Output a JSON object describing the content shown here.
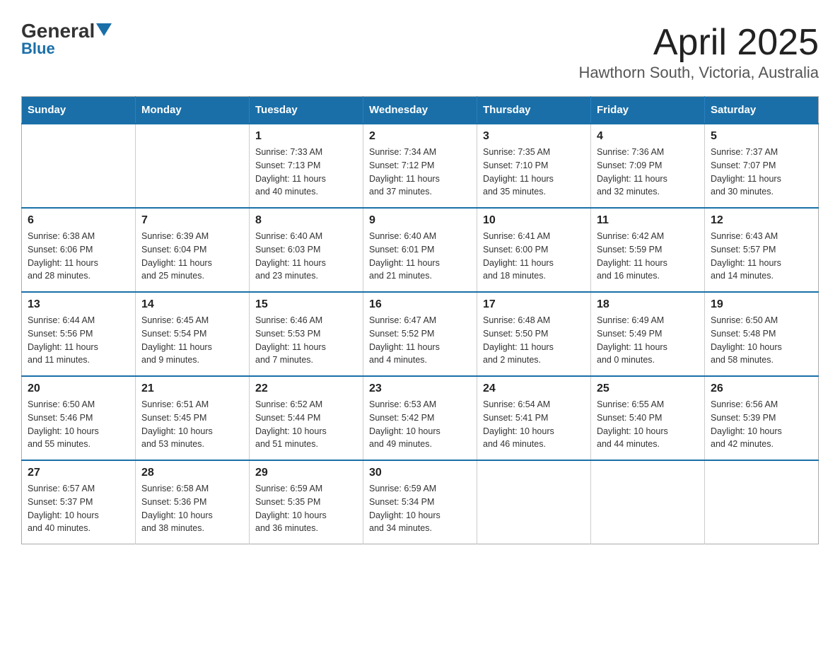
{
  "header": {
    "logo_general": "General",
    "logo_blue": "Blue",
    "title": "April 2025",
    "subtitle": "Hawthorn South, Victoria, Australia"
  },
  "calendar": {
    "days_of_week": [
      "Sunday",
      "Monday",
      "Tuesday",
      "Wednesday",
      "Thursday",
      "Friday",
      "Saturday"
    ],
    "weeks": [
      [
        {
          "day": "",
          "info": ""
        },
        {
          "day": "",
          "info": ""
        },
        {
          "day": "1",
          "info": "Sunrise: 7:33 AM\nSunset: 7:13 PM\nDaylight: 11 hours\nand 40 minutes."
        },
        {
          "day": "2",
          "info": "Sunrise: 7:34 AM\nSunset: 7:12 PM\nDaylight: 11 hours\nand 37 minutes."
        },
        {
          "day": "3",
          "info": "Sunrise: 7:35 AM\nSunset: 7:10 PM\nDaylight: 11 hours\nand 35 minutes."
        },
        {
          "day": "4",
          "info": "Sunrise: 7:36 AM\nSunset: 7:09 PM\nDaylight: 11 hours\nand 32 minutes."
        },
        {
          "day": "5",
          "info": "Sunrise: 7:37 AM\nSunset: 7:07 PM\nDaylight: 11 hours\nand 30 minutes."
        }
      ],
      [
        {
          "day": "6",
          "info": "Sunrise: 6:38 AM\nSunset: 6:06 PM\nDaylight: 11 hours\nand 28 minutes."
        },
        {
          "day": "7",
          "info": "Sunrise: 6:39 AM\nSunset: 6:04 PM\nDaylight: 11 hours\nand 25 minutes."
        },
        {
          "day": "8",
          "info": "Sunrise: 6:40 AM\nSunset: 6:03 PM\nDaylight: 11 hours\nand 23 minutes."
        },
        {
          "day": "9",
          "info": "Sunrise: 6:40 AM\nSunset: 6:01 PM\nDaylight: 11 hours\nand 21 minutes."
        },
        {
          "day": "10",
          "info": "Sunrise: 6:41 AM\nSunset: 6:00 PM\nDaylight: 11 hours\nand 18 minutes."
        },
        {
          "day": "11",
          "info": "Sunrise: 6:42 AM\nSunset: 5:59 PM\nDaylight: 11 hours\nand 16 minutes."
        },
        {
          "day": "12",
          "info": "Sunrise: 6:43 AM\nSunset: 5:57 PM\nDaylight: 11 hours\nand 14 minutes."
        }
      ],
      [
        {
          "day": "13",
          "info": "Sunrise: 6:44 AM\nSunset: 5:56 PM\nDaylight: 11 hours\nand 11 minutes."
        },
        {
          "day": "14",
          "info": "Sunrise: 6:45 AM\nSunset: 5:54 PM\nDaylight: 11 hours\nand 9 minutes."
        },
        {
          "day": "15",
          "info": "Sunrise: 6:46 AM\nSunset: 5:53 PM\nDaylight: 11 hours\nand 7 minutes."
        },
        {
          "day": "16",
          "info": "Sunrise: 6:47 AM\nSunset: 5:52 PM\nDaylight: 11 hours\nand 4 minutes."
        },
        {
          "day": "17",
          "info": "Sunrise: 6:48 AM\nSunset: 5:50 PM\nDaylight: 11 hours\nand 2 minutes."
        },
        {
          "day": "18",
          "info": "Sunrise: 6:49 AM\nSunset: 5:49 PM\nDaylight: 11 hours\nand 0 minutes."
        },
        {
          "day": "19",
          "info": "Sunrise: 6:50 AM\nSunset: 5:48 PM\nDaylight: 10 hours\nand 58 minutes."
        }
      ],
      [
        {
          "day": "20",
          "info": "Sunrise: 6:50 AM\nSunset: 5:46 PM\nDaylight: 10 hours\nand 55 minutes."
        },
        {
          "day": "21",
          "info": "Sunrise: 6:51 AM\nSunset: 5:45 PM\nDaylight: 10 hours\nand 53 minutes."
        },
        {
          "day": "22",
          "info": "Sunrise: 6:52 AM\nSunset: 5:44 PM\nDaylight: 10 hours\nand 51 minutes."
        },
        {
          "day": "23",
          "info": "Sunrise: 6:53 AM\nSunset: 5:42 PM\nDaylight: 10 hours\nand 49 minutes."
        },
        {
          "day": "24",
          "info": "Sunrise: 6:54 AM\nSunset: 5:41 PM\nDaylight: 10 hours\nand 46 minutes."
        },
        {
          "day": "25",
          "info": "Sunrise: 6:55 AM\nSunset: 5:40 PM\nDaylight: 10 hours\nand 44 minutes."
        },
        {
          "day": "26",
          "info": "Sunrise: 6:56 AM\nSunset: 5:39 PM\nDaylight: 10 hours\nand 42 minutes."
        }
      ],
      [
        {
          "day": "27",
          "info": "Sunrise: 6:57 AM\nSunset: 5:37 PM\nDaylight: 10 hours\nand 40 minutes."
        },
        {
          "day": "28",
          "info": "Sunrise: 6:58 AM\nSunset: 5:36 PM\nDaylight: 10 hours\nand 38 minutes."
        },
        {
          "day": "29",
          "info": "Sunrise: 6:59 AM\nSunset: 5:35 PM\nDaylight: 10 hours\nand 36 minutes."
        },
        {
          "day": "30",
          "info": "Sunrise: 6:59 AM\nSunset: 5:34 PM\nDaylight: 10 hours\nand 34 minutes."
        },
        {
          "day": "",
          "info": ""
        },
        {
          "day": "",
          "info": ""
        },
        {
          "day": "",
          "info": ""
        }
      ]
    ]
  }
}
